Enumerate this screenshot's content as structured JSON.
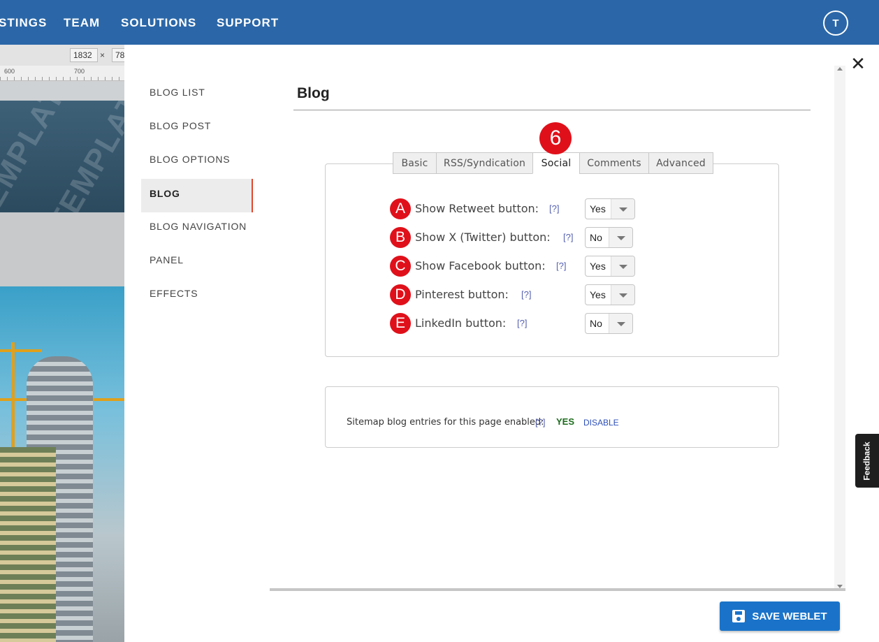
{
  "topnav": {
    "items": [
      "STINGS",
      "TEAM",
      "SOLUTIONS",
      "SUPPORT"
    ],
    "avatar": "T"
  },
  "background": {
    "width_value": "1832",
    "times": "×",
    "height_value": "78",
    "ruler_labels": [
      "600",
      "700"
    ],
    "watermark": "TEMPLATE"
  },
  "sidebar": {
    "items": [
      {
        "label": "BLOG LIST"
      },
      {
        "label": "BLOG POST"
      },
      {
        "label": "BLOG OPTIONS"
      },
      {
        "label": "BLOG"
      },
      {
        "label": "BLOG NAVIGATION"
      },
      {
        "label": "PANEL"
      },
      {
        "label": "EFFECTS"
      }
    ],
    "active": "BLOG"
  },
  "main": {
    "title": "Blog",
    "step": "6",
    "tabs": [
      {
        "label": "Basic"
      },
      {
        "label": "RSS/Syndication"
      },
      {
        "label": "Social"
      },
      {
        "label": "Comments"
      },
      {
        "label": "Advanced"
      }
    ],
    "active_tab": "Social",
    "settings": [
      {
        "badge": "A",
        "label": "Show Retweet button:",
        "help": "[?]",
        "value": "Yes"
      },
      {
        "badge": "B",
        "label": "Show X (Twitter) button:",
        "help": "[?]",
        "value": "No"
      },
      {
        "badge": "C",
        "label": "Show Facebook button:",
        "help": "[?]",
        "value": "Yes"
      },
      {
        "badge": "D",
        "label": "Pinterest button:",
        "help": "[?]",
        "value": "Yes"
      },
      {
        "badge": "E",
        "label": "LinkedIn button:",
        "help": "[?]",
        "value": "No"
      }
    ],
    "sitemap": {
      "label": "Sitemap blog entries for this page enabled:",
      "help": "[?]",
      "status": "YES",
      "action": "DISABLE"
    }
  },
  "footer": {
    "save_label": "SAVE WEBLET"
  },
  "feedback_label": "Feedback",
  "close_symbol": "✕",
  "colors": {
    "nav_bg": "#2b67a8",
    "accent_red": "#e0101a",
    "save_blue": "#1a73c9",
    "active_border": "#e2452b"
  }
}
